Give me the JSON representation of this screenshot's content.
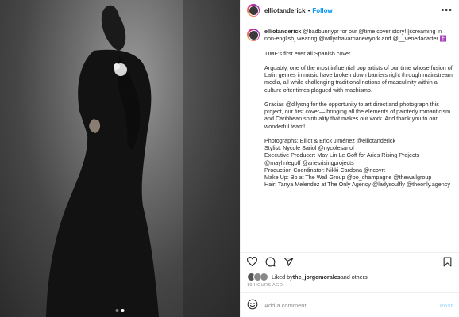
{
  "header": {
    "username": "elliotanderick",
    "separator": "•",
    "follow_label": "Follow",
    "more_label": "•••"
  },
  "caption": {
    "username": "elliotanderick",
    "text": "@badbunnypr for our @time cover story! [screaming in non-english] wearing @willychavarrianewyork and @__venedacarter ✝️\n\nTIME's first ever all Spanish cover.\n\nArguably, one of the most influential pop artists of our time whose fusion of Latin genres in music have broken down barriers right through mainstream media, all while challenging traditional notions of masculinity within a culture oftentimes plagued with machismo.\n\nGracias @dilysng for the opportunity to art direct and photograph this project, our first cover— bringing all the elements of painterly romanticism and Caribbean spirituality that makes our work. And thank you to our wonderful team!\n\nPhotographs: Elliot & Erick Jiménez @elliotanderick\nStylist: Nycole Sariol @nycolesariol\nExecutive Producer: May Lin Le Goff for Aries Rising Projects @maylinlegoff @ariesrisingprojects\nProduction Coordinator: Nikki Cardona @ncovrt\nMake Up: Bo at The Wall Group @bo_champagne @thewallgroup\nHair: Tanya Melendez at The Only Agency @ladysoulfly @theonly.agency"
  },
  "likes": {
    "prefix": "Liked by ",
    "user": "the_jorgemorales",
    "suffix": " and others"
  },
  "timestamp": "19 HOURS AGO",
  "comment": {
    "placeholder": "Add a comment...",
    "post_label": "Post"
  },
  "icons": [
    "heart-icon",
    "comment-icon",
    "share-icon",
    "bookmark-icon",
    "emoji-icon"
  ],
  "colors": {
    "accent": "#0095f6",
    "link": "#00376b",
    "post_disabled": "#b2dffc"
  },
  "carousel": {
    "count": 2,
    "active": 2
  }
}
